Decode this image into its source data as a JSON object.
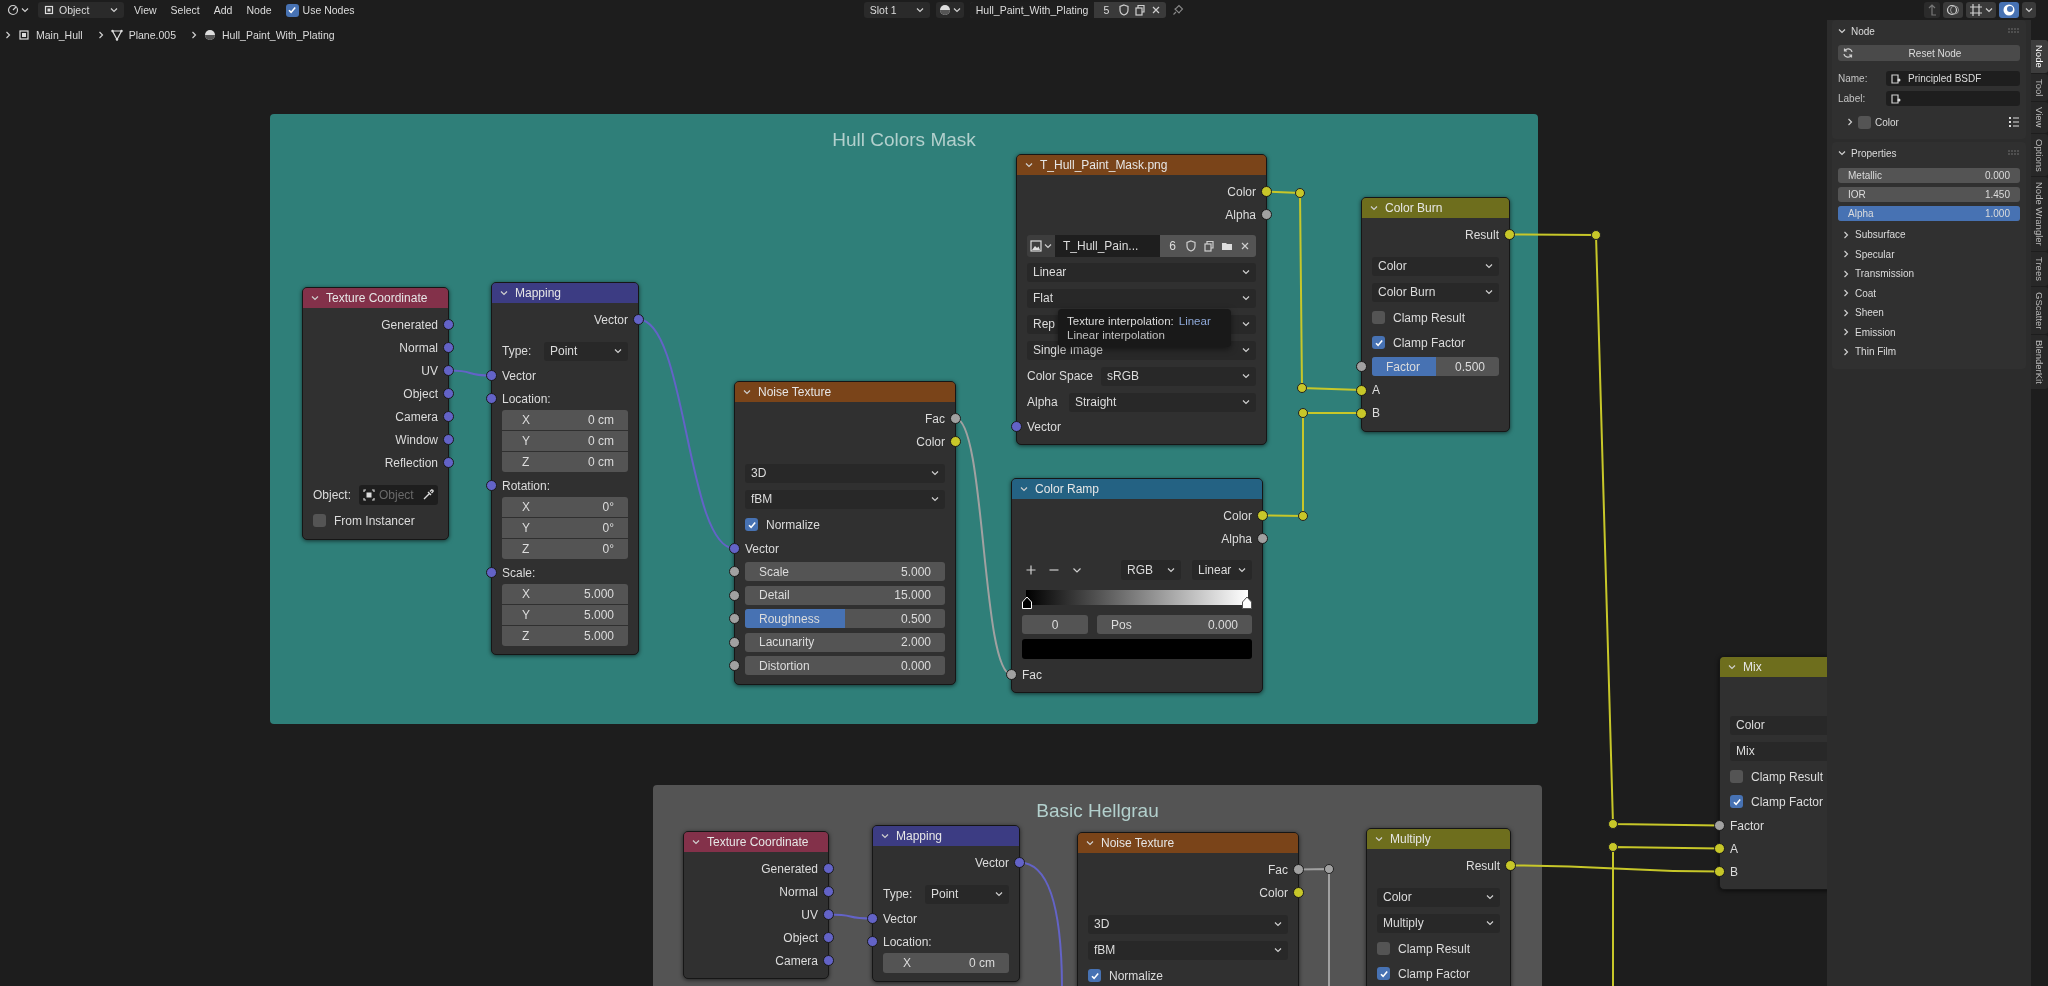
{
  "header": {
    "mode": "Object",
    "menus": [
      "View",
      "Select",
      "Add",
      "Node"
    ],
    "use_nodes": {
      "label": "Use Nodes",
      "checked": true
    },
    "slot": "Slot 1",
    "material": {
      "name": "Hull_Paint_With_Plating",
      "users": "5"
    }
  },
  "breadcrumbs": [
    {
      "kind": "object",
      "label": "Main_Hull"
    },
    {
      "kind": "mesh",
      "label": "Plane.005"
    },
    {
      "kind": "material",
      "label": "Hull_Paint_With_Plating"
    }
  ],
  "frames": [
    {
      "label": "Hull Colors Mask",
      "color": "#2f7f79"
    },
    {
      "label": "Basic Hellgrau",
      "color": "#545454"
    }
  ],
  "nodes": [
    {
      "title": "Texture Coordinate",
      "color": "#83314a",
      "rows": [
        {
          "kind": "output",
          "label": "Generated",
          "color": "#6363c7"
        },
        {
          "kind": "output",
          "label": "Normal",
          "color": "#6363c7"
        },
        {
          "kind": "output",
          "label": "UV",
          "color": "#6363c7"
        },
        {
          "kind": "output",
          "label": "Object",
          "color": "#6363c7"
        },
        {
          "kind": "output",
          "label": "Camera",
          "color": "#6363c7"
        },
        {
          "kind": "output",
          "label": "Window",
          "color": "#6363c7"
        },
        {
          "kind": "output",
          "label": "Reflection",
          "color": "#6363c7"
        },
        {
          "kind": "object",
          "label": "Object:",
          "placeholder": "Object"
        },
        {
          "kind": "checkbox",
          "label": "From Instancer",
          "checked": false
        }
      ]
    },
    {
      "title": "Mapping",
      "color": "#3c3c83",
      "rows": [
        {
          "kind": "output",
          "label": "Vector",
          "color": "#6363c7"
        },
        {
          "kind": "dropdown",
          "label": "Type:",
          "value": "Point"
        },
        {
          "kind": "input",
          "label": "Vector",
          "color": "#6363c7"
        },
        {
          "kind": "vector",
          "label": "Location:",
          "color": "#6363c7",
          "fields": [
            {
              "axis": "X",
              "value": "0 cm"
            },
            {
              "axis": "Y",
              "value": "0 cm"
            },
            {
              "axis": "Z",
              "value": "0 cm"
            }
          ]
        },
        {
          "kind": "vector",
          "label": "Rotation:",
          "color": "#6363c7",
          "fields": [
            {
              "axis": "X",
              "value": "0°"
            },
            {
              "axis": "Y",
              "value": "0°"
            },
            {
              "axis": "Z",
              "value": "0°"
            }
          ]
        },
        {
          "kind": "vector",
          "label": "Scale:",
          "color": "#6363c7",
          "fields": [
            {
              "axis": "X",
              "value": "5.000"
            },
            {
              "axis": "Y",
              "value": "5.000"
            },
            {
              "axis": "Z",
              "value": "5.000"
            }
          ]
        }
      ]
    },
    {
      "title": "Noise Texture",
      "color": "#7a4419",
      "rows": [
        {
          "kind": "output",
          "label": "Fac",
          "color": "#a1a1a1"
        },
        {
          "kind": "output",
          "label": "Color",
          "color": "#c7c729"
        },
        {
          "kind": "dropdown",
          "value": "3D"
        },
        {
          "kind": "dropdown",
          "value": "fBM"
        },
        {
          "kind": "checkbox",
          "label": "Normalize",
          "checked": true
        },
        {
          "kind": "input",
          "label": "Vector",
          "color": "#6363c7"
        },
        {
          "kind": "number",
          "label": "Scale",
          "value": "5.000",
          "color": "#a1a1a1"
        },
        {
          "kind": "number",
          "label": "Detail",
          "value": "15.000",
          "color": "#a1a1a1"
        },
        {
          "kind": "slider",
          "label": "Roughness",
          "value": "0.500",
          "level": 0.5,
          "color": "#a1a1a1"
        },
        {
          "kind": "number",
          "label": "Lacunarity",
          "value": "2.000",
          "color": "#a1a1a1"
        },
        {
          "kind": "number",
          "label": "Distortion",
          "value": "0.000",
          "color": "#a1a1a1"
        }
      ]
    },
    {
      "title": "T_Hull_Paint_Mask.png",
      "color": "#7a4419",
      "rows": [
        {
          "kind": "output",
          "label": "Color",
          "color": "#c7c729"
        },
        {
          "kind": "output",
          "label": "Alpha",
          "color": "#a1a1a1"
        },
        {
          "kind": "image",
          "name": "T_Hull_Pain...",
          "users": "6"
        },
        {
          "kind": "dropdown",
          "value": "Linear"
        },
        {
          "kind": "dropdown",
          "value": "Flat"
        },
        {
          "kind": "dropdown",
          "value": "Rep"
        },
        {
          "kind": "dropdown",
          "value": "Single Image"
        },
        {
          "kind": "dropdown",
          "label": "Color Space",
          "value": "sRGB"
        },
        {
          "kind": "dropdown",
          "label": "Alpha",
          "value": "Straight"
        },
        {
          "kind": "input",
          "label": "Vector",
          "color": "#6363c7"
        }
      ]
    },
    {
      "title": "Color Ramp",
      "color": "#246283",
      "rows": [
        {
          "kind": "output",
          "label": "Color",
          "color": "#c7c729"
        },
        {
          "kind": "output",
          "label": "Alpha",
          "color": "#a1a1a1"
        },
        {
          "kind": "ramp",
          "color_mode": "RGB",
          "interpolation": "Linear",
          "index": "0",
          "pos_label": "Pos",
          "pos_value": "0.000"
        },
        {
          "kind": "input",
          "label": "Fac",
          "color": "#a1a1a1"
        }
      ]
    },
    {
      "title": "Color Burn",
      "color": "#6e6e1d",
      "rows": [
        {
          "kind": "output",
          "label": "Result",
          "color": "#c7c729"
        },
        {
          "kind": "dropdown",
          "value": "Color"
        },
        {
          "kind": "dropdown",
          "value": "Color Burn"
        },
        {
          "kind": "checkbox",
          "label": "Clamp Result",
          "checked": false
        },
        {
          "kind": "checkbox",
          "label": "Clamp Factor",
          "checked": true
        },
        {
          "kind": "slider",
          "label": "Factor",
          "value": "0.500",
          "level": 0.5,
          "color": "#a1a1a1"
        },
        {
          "kind": "input",
          "label": "A",
          "color": "#c7c729"
        },
        {
          "kind": "input",
          "label": "B",
          "color": "#c7c729"
        }
      ]
    },
    {
      "title": "Mix",
      "color": "#6e6e1d",
      "rows": [
        {
          "kind": "output"
        },
        {
          "kind": "dropdown",
          "value": "Color"
        },
        {
          "kind": "dropdown",
          "value": "Mix"
        },
        {
          "kind": "checkbox",
          "label": "Clamp Result",
          "checked": false
        },
        {
          "kind": "checkbox",
          "label": "Clamp Factor",
          "checked": true
        },
        {
          "kind": "input",
          "label": "Factor",
          "color": "#a1a1a1"
        },
        {
          "kind": "input",
          "label": "A",
          "color": "#c7c729"
        },
        {
          "kind": "input",
          "label": "B",
          "color": "#c7c729"
        }
      ]
    },
    {
      "title": "Texture Coordinate",
      "color": "#83314a",
      "rows": [
        {
          "kind": "output",
          "label": "Generated",
          "color": "#6363c7"
        },
        {
          "kind": "output",
          "label": "Normal",
          "color": "#6363c7"
        },
        {
          "kind": "output",
          "label": "UV",
          "color": "#6363c7"
        },
        {
          "kind": "output",
          "label": "Object",
          "color": "#6363c7"
        },
        {
          "kind": "output",
          "label": "Camera",
          "color": "#6363c7"
        }
      ]
    },
    {
      "title": "Mapping",
      "color": "#3c3c83",
      "rows": [
        {
          "kind": "output",
          "label": "Vector",
          "color": "#6363c7"
        },
        {
          "kind": "dropdown",
          "label": "Type:",
          "value": "Point"
        },
        {
          "kind": "input",
          "label": "Vector",
          "color": "#6363c7"
        },
        {
          "kind": "vector",
          "label": "Location:",
          "color": "#6363c7",
          "fields": [
            {
              "axis": "X",
              "value": "0 cm"
            }
          ]
        }
      ]
    },
    {
      "title": "Noise Texture",
      "color": "#7a4419",
      "rows": [
        {
          "kind": "output",
          "label": "Fac",
          "color": "#a1a1a1"
        },
        {
          "kind": "output",
          "label": "Color",
          "color": "#c7c729"
        },
        {
          "kind": "dropdown",
          "value": "3D"
        },
        {
          "kind": "dropdown",
          "value": "fBM"
        },
        {
          "kind": "checkbox",
          "label": "Normalize",
          "checked": true
        }
      ]
    },
    {
      "title": "Multiply",
      "color": "#6e6e1d",
      "rows": [
        {
          "kind": "output",
          "label": "Result",
          "color": "#c7c729"
        },
        {
          "kind": "dropdown",
          "value": "Color"
        },
        {
          "kind": "dropdown",
          "value": "Multiply"
        },
        {
          "kind": "checkbox",
          "label": "Clamp Result",
          "checked": false
        },
        {
          "kind": "checkbox",
          "label": "Clamp Factor",
          "checked": true
        }
      ]
    }
  ],
  "tooltip": {
    "title": "Texture interpolation:",
    "value": "Linear",
    "description": "Linear interpolation"
  },
  "sidebar": {
    "tabs": [
      {
        "label": "Node",
        "selected": true
      },
      {
        "label": "Tool",
        "selected": false
      },
      {
        "label": "View",
        "selected": false
      },
      {
        "label": "Options",
        "selected": false
      },
      {
        "label": "Node Wrangler",
        "selected": false
      },
      {
        "label": "Trees",
        "selected": false
      },
      {
        "label": "GScatter",
        "selected": false
      },
      {
        "label": "BlenderKit",
        "selected": false
      }
    ],
    "node_panel": {
      "title": "Node",
      "expanded": true,
      "reset_button": "Reset Node",
      "name_label": "Name:",
      "name_value": "Principled BSDF",
      "label_label": "Label:",
      "color": {
        "label": "Color",
        "checked": false,
        "expanded": false
      }
    },
    "properties_panel": {
      "title": "Properties",
      "expanded": true,
      "fields": [
        {
          "label": "Metallic",
          "value": "0.000"
        },
        {
          "label": "IOR",
          "value": "1.450"
        },
        {
          "label": "Alpha",
          "value": "1.000",
          "level": 1
        }
      ],
      "sections": [
        {
          "label": "Subsurface",
          "expanded": false
        },
        {
          "label": "Specular",
          "expanded": false
        },
        {
          "label": "Transmission",
          "expanded": false
        },
        {
          "label": "Coat",
          "expanded": false
        },
        {
          "label": "Sheen",
          "expanded": false
        },
        {
          "label": "Emission",
          "expanded": false
        },
        {
          "label": "Thin Film",
          "expanded": false
        }
      ]
    }
  }
}
